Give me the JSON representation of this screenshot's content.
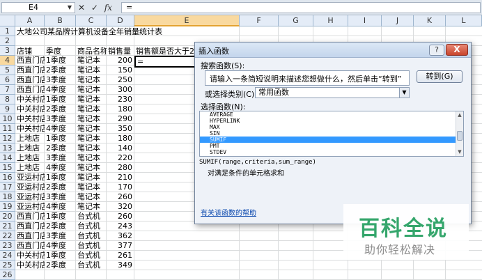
{
  "formula_bar": {
    "name_box": "E4",
    "buttons": [
      "✕",
      "✓",
      "fx"
    ],
    "formula": "="
  },
  "columns": [
    "A",
    "B",
    "C",
    "D",
    "E",
    "F",
    "G",
    "H",
    "I",
    "J",
    "K",
    "L"
  ],
  "selected_column": "E",
  "rows": [
    "1",
    "2",
    "3",
    "4",
    "5",
    "6",
    "7",
    "8",
    "9",
    "10",
    "11",
    "12",
    "13",
    "14",
    "15",
    "16",
    "17",
    "18",
    "19",
    "20",
    "21",
    "22",
    "23",
    "24",
    "25",
    "26"
  ],
  "selected_row": "4",
  "sheet": {
    "title": "大地公司某品牌计算机设备全年销量统计表",
    "headers": [
      "店铺",
      "季度",
      "商品名称",
      "销售量",
      "销售额是否大于2"
    ],
    "active_cell_value": "=",
    "data": [
      [
        "西直门店",
        "1季度",
        "笔记本",
        "200"
      ],
      [
        "西直门店",
        "2季度",
        "笔记本",
        "150"
      ],
      [
        "西直门店",
        "3季度",
        "笔记本",
        "250"
      ],
      [
        "西直门店",
        "4季度",
        "笔记本",
        "300"
      ],
      [
        "中关村店",
        "1季度",
        "笔记本",
        "230"
      ],
      [
        "中关村店",
        "2季度",
        "笔记本",
        "180"
      ],
      [
        "中关村店",
        "3季度",
        "笔记本",
        "290"
      ],
      [
        "中关村店",
        "4季度",
        "笔记本",
        "350"
      ],
      [
        "上地店",
        "1季度",
        "笔记本",
        "180"
      ],
      [
        "上地店",
        "2季度",
        "笔记本",
        "140"
      ],
      [
        "上地店",
        "3季度",
        "笔记本",
        "220"
      ],
      [
        "上地店",
        "4季度",
        "笔记本",
        "280"
      ],
      [
        "亚运村店",
        "1季度",
        "笔记本",
        "210"
      ],
      [
        "亚运村店",
        "2季度",
        "笔记本",
        "170"
      ],
      [
        "亚运村店",
        "3季度",
        "笔记本",
        "260"
      ],
      [
        "亚运村店",
        "4季度",
        "笔记本",
        "320"
      ],
      [
        "西直门店",
        "1季度",
        "台式机",
        "260"
      ],
      [
        "西直门店",
        "2季度",
        "台式机",
        "243"
      ],
      [
        "西直门店",
        "3季度",
        "台式机",
        "362"
      ],
      [
        "西直门店",
        "4季度",
        "台式机",
        "377"
      ],
      [
        "中关村店",
        "1季度",
        "台式机",
        "261"
      ],
      [
        "中关村店",
        "2季度",
        "台式机",
        "349"
      ]
    ]
  },
  "dialog": {
    "title": "插入函数",
    "help_label": "?",
    "close_label": "X",
    "search_label": "搜索函数(S):",
    "search_text": "请输入一条简短说明来描述您想做什么，然后单击“转到”",
    "go_button": "转到(G)",
    "category_label": "或选择类别(C):",
    "category_value": "常用函数",
    "function_label": "选择函数(N):",
    "functions": [
      "AVERAGE",
      "HYPERLINK",
      "MAX",
      "SIN",
      "SUMIF",
      "PMT",
      "STDEV"
    ],
    "selected_function": "SUMIF",
    "signature": "SUMIF(range,criteria,sum_range)",
    "description": "对满足条件的单元格求和",
    "help_link": "有关该函数的帮助"
  },
  "watermark": {
    "brand": "百科全说",
    "slogan": "助你轻松解决"
  }
}
